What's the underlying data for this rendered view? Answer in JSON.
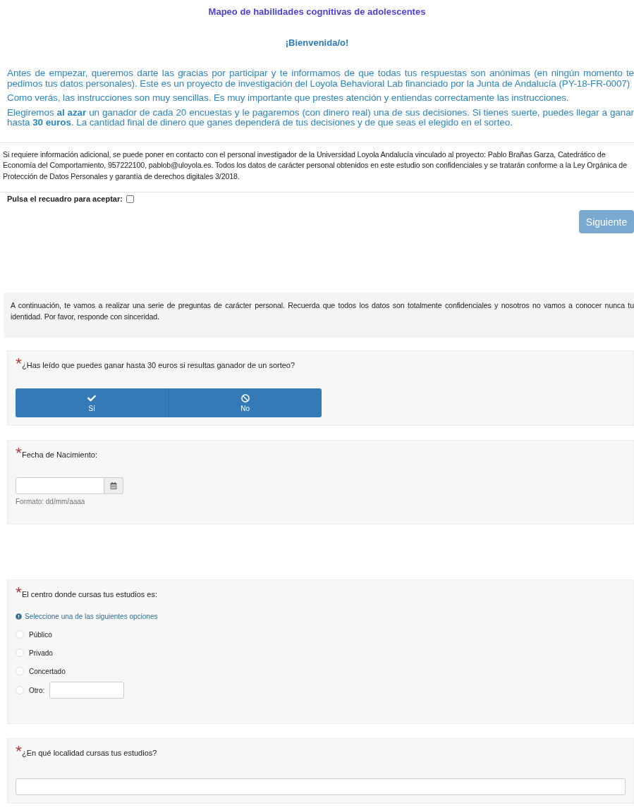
{
  "title": "Mapeo de habilidades cognitivas de adolescentes",
  "welcome": "¡Bienvenida/o!",
  "intro": [
    "Antes de empezar, queremos darte las gracias por participar y te informamos de que todas tus respuestas son anónimas (en ningún momento te pedimos tus datos personales). Este es un proyecto de investigación del Loyola Behavioral Lab financiado por la Junta de Andalucía (PY-18-FR-0007)",
    "Como verás, las instrucciones son muy sencillas. Es muy importante que prestes atención y entiendas correctamente las instrucciones.",
    "Elegiremos **al azar** un ganador de cada 20 encuestas y le pagaremos (con dinero real) una de sus decisiones. Si tienes suerte, puedes llegar a ganar hasta **30 euros**. La cantidad final de dinero que ganes dependerá de tus decisiones y de que seas el elegido en el sorteo."
  ],
  "contact_note": "Si requiere información adicional, se puede poner en contacto con el personal investigador de la Universidad Loyola Andalucía vinculado al proyecto: Pablo Brañas Garza, Catedrático de Economía del Comportamiento, 957222100, pablob@uloyola.es. Todos los datos de carácter personal obtenidos en este estudio son confidenciales y se tratarán conforme a la Ley Orgánica de Protección de Datos Personales y garantía de derechos digitales 3/2018.",
  "consent": {
    "label": "Pulsa el recuadro para aceptar:",
    "checked": false
  },
  "next_button": {
    "label": "Siguiente",
    "disabled": true
  },
  "notice": "A continuación, te vamos a realizar una serie de preguntas de carácter personal. Recuerda que todos los datos son totalmente confidenciales y nosotros no vamos a conocer nunca tu identidad. Por favor, responde con sinceridad.",
  "questions": [
    {
      "kind": "buttons",
      "required": true,
      "label": "¿Has leído que puedes ganar hasta 30 euros si resultas ganador de un sorteo?",
      "options": [
        {
          "label": "Sí",
          "selected": false
        },
        {
          "label": "No",
          "selected": false
        }
      ]
    },
    {
      "kind": "date",
      "required": true,
      "label": "Fecha de Nacimiento:",
      "help": "Formato: dd/mm/aaaa"
    },
    {
      "kind": "radio",
      "required": true,
      "label": "El centro donde cursas tus estudios es:",
      "hint": "Seleccione una de las siguientes opciones",
      "options": [
        {
          "kind": "plain",
          "label": "Público",
          "selected": false
        },
        {
          "kind": "plain",
          "label": "Privado",
          "selected": false
        },
        {
          "kind": "plain",
          "label": "Concertado",
          "selected": false
        },
        {
          "kind": "with_text",
          "label": "Otro:",
          "selected": false
        }
      ]
    },
    {
      "kind": "text",
      "required": true,
      "label": "¿En qué localidad cursas tus estudios?"
    }
  ]
}
